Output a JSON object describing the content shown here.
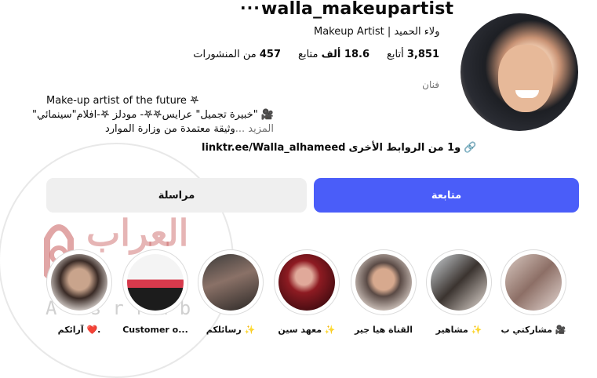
{
  "profile": {
    "username": "walla_makeupartist",
    "more_label": "···",
    "full_name": "ولاء الحميد | Makeup Artist",
    "stats": {
      "posts_value": "457",
      "posts_label": "من المنشورات",
      "followers_value": "18.6 ألف",
      "followers_label": "متابع",
      "following_value": "3,851",
      "following_label": "أتابع"
    },
    "category": "فنان",
    "bio": {
      "line1": "Make-up artist of the future 𖤐",
      "line2": "🎥 \"خبيرة تجميل\" عرايس𖤐𖤐- مودلز 𖤐-افلام\"سينمائي\"",
      "line3": "وثيقة معتمدة من وزارة الموارد",
      "more": "المزيد ..."
    },
    "link": {
      "url": "linktr.ee/Walla_alhameed",
      "suffix": "و1 من الروابط الأخرى",
      "icon": "link-icon"
    },
    "avatar_icon": "profile-photo"
  },
  "buttons": {
    "follow": "متابعة",
    "message": "مراسلة"
  },
  "highlights": [
    {
      "label": "مشاركتي ب 🎥"
    },
    {
      "label": "مشاهير ✨"
    },
    {
      "label": "القناة هيا جير"
    },
    {
      "label": "معهد سين ✨"
    },
    {
      "label": "رسائلكم ✨"
    },
    {
      "label": "Customer o..."
    },
    {
      "label": "آرائكم ❤️."
    }
  ],
  "watermark": {
    "logo_text": "العراب",
    "text": "Alsrrab"
  },
  "colors": {
    "accent": "#4a5df9",
    "secondary_button": "#efefef",
    "muted_text": "#737373"
  }
}
